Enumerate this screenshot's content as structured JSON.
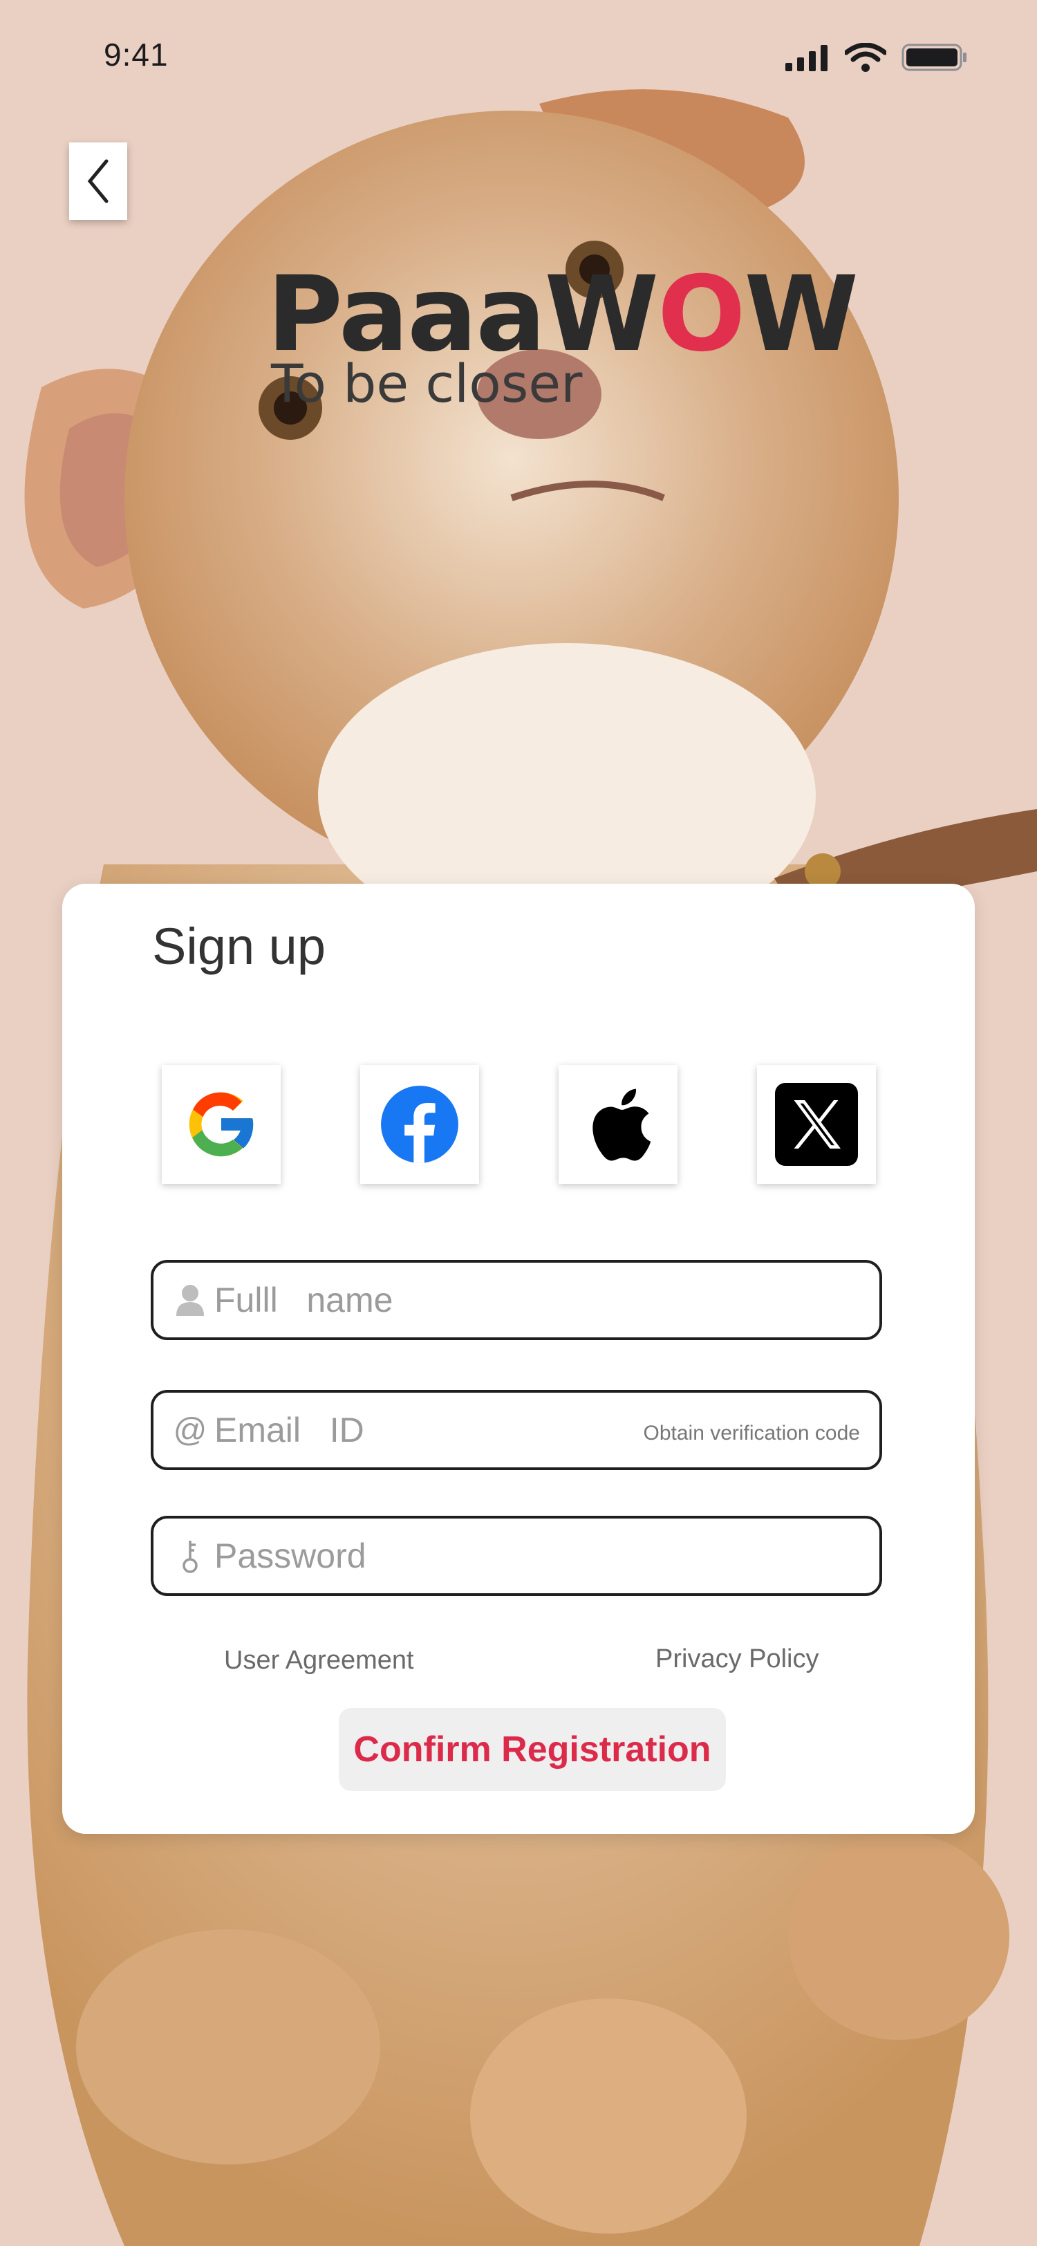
{
  "status_bar": {
    "time": "9:41"
  },
  "brand": {
    "logo_part1": "PaaaW",
    "logo_o": "O",
    "logo_part2": "W",
    "tagline": "To be closer"
  },
  "card": {
    "title": "Sign up",
    "social": [
      "google-icon",
      "facebook-icon",
      "apple-icon",
      "x-icon"
    ],
    "fields": {
      "full_name": {
        "placeholder": "Fulll   name",
        "icon": "person-icon"
      },
      "email": {
        "placeholder": "Email   ID",
        "icon": "at-icon",
        "action": "Obtain verification code"
      },
      "password": {
        "placeholder": "Password",
        "icon": "key-icon"
      }
    },
    "links": {
      "user_agreement": "User Agreement",
      "privacy_policy": "Privacy Policy"
    },
    "confirm_label": "Confirm Registration"
  },
  "colors": {
    "accent": "#dc2a4a",
    "card": "#ffffff",
    "background": "#e9cdbf"
  }
}
